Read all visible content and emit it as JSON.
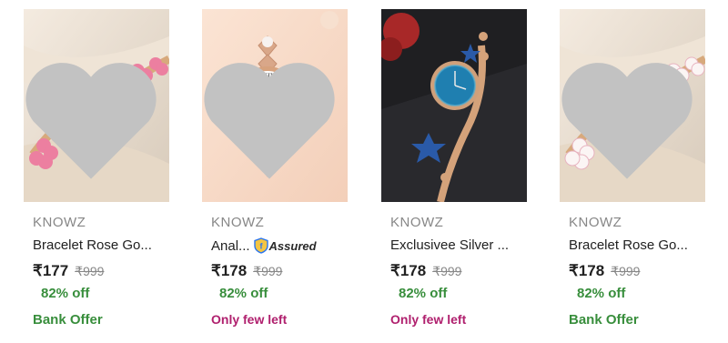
{
  "products": [
    {
      "brand": "KNOWZ",
      "title": "Bracelet Rose Go...",
      "price": "₹177",
      "mrp": "₹999",
      "discount": "82% off",
      "offer": "Bank Offer",
      "offer_type": "bank",
      "image": "rose-gold-pink-flower-bracelet-watch",
      "wishlist_icon": "heart-icon",
      "assured": false
    },
    {
      "brand": "KNOWZ",
      "title": "Anal...",
      "assured_label": "Assured",
      "price": "₹178",
      "mrp": "₹999",
      "discount": "82% off",
      "offer": "Only few left",
      "offer_type": "few",
      "image": "rose-gold-heart-link-watch",
      "wishlist_icon": "heart-icon",
      "assured": true
    },
    {
      "brand": "KNOWZ",
      "title": "Exclusivee Silver ...",
      "price": "₹178",
      "mrp": "₹999",
      "discount": "82% off",
      "offer": "Only few left",
      "offer_type": "few",
      "image": "blue-dial-star-bracelet-watch",
      "wishlist_icon": "heart-icon",
      "assured": false
    },
    {
      "brand": "KNOWZ",
      "title": "Bracelet Rose Go...",
      "price": "₹178",
      "mrp": "₹999",
      "discount": "82% off",
      "offer": "Bank Offer",
      "offer_type": "bank",
      "image": "rose-gold-white-flower-bracelet-watch",
      "wishlist_icon": "heart-icon",
      "assured": false
    }
  ],
  "colors": {
    "discount_green": "#388e3c",
    "few_left_magenta": "#b0206e",
    "brand_grey": "#878787"
  }
}
